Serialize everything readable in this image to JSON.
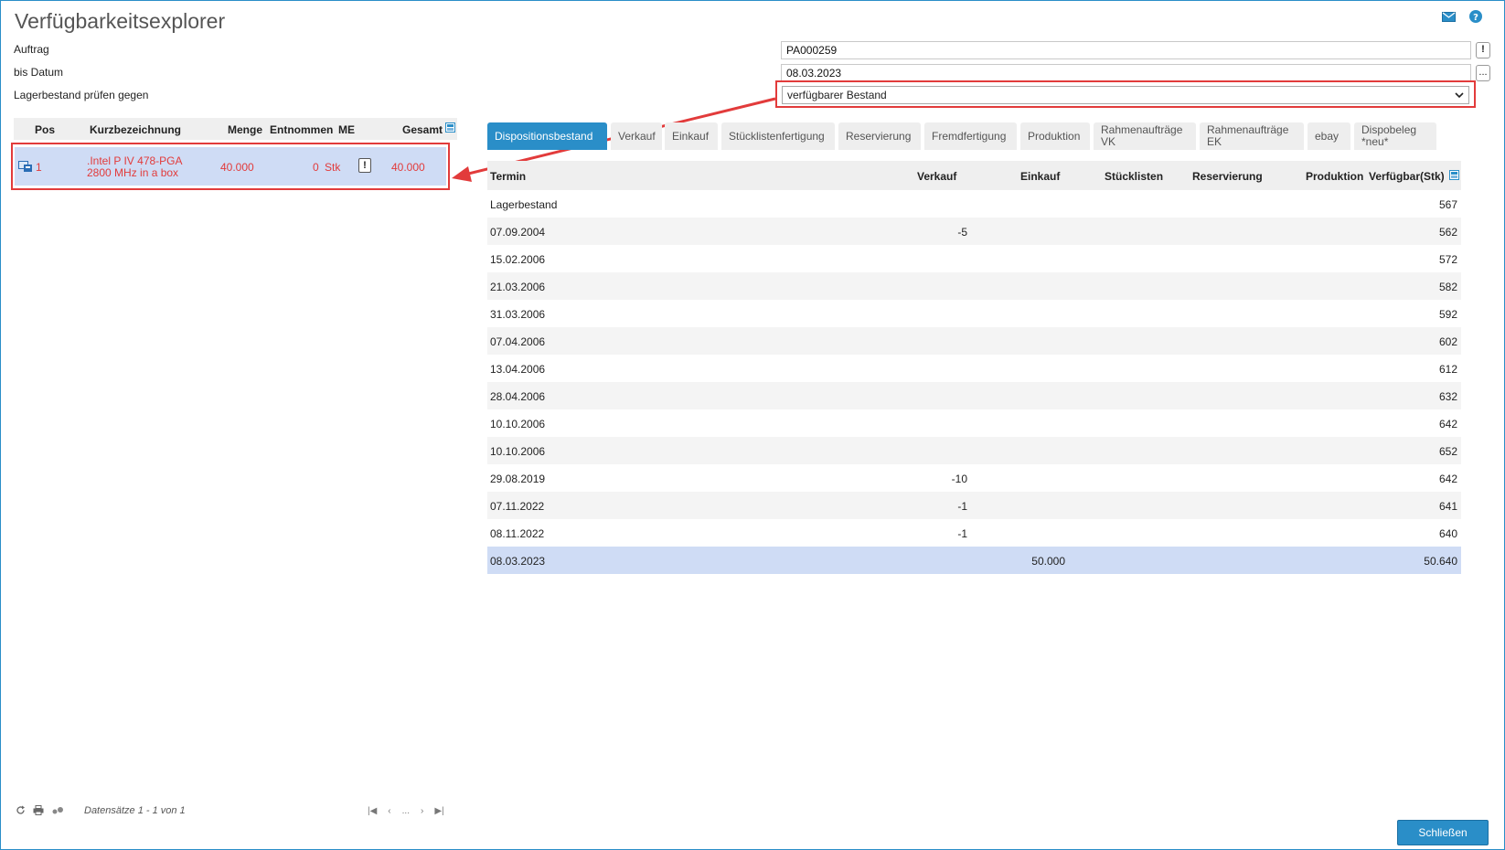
{
  "window_title": "Verfügbarkeitsexplorer",
  "icons": {
    "mail": "mail-icon",
    "help": "help-icon"
  },
  "form": {
    "auftrag_label": "Auftrag",
    "auftrag_value": "PA000259",
    "auftrag_btn": "!",
    "datum_label": "bis Datum",
    "datum_value": "08.03.2023",
    "datum_btn": "...",
    "lager_label": "Lagerbestand prüfen gegen",
    "lager_value": "verfügbarer Bestand"
  },
  "left_grid": {
    "headers": {
      "pos": "Pos",
      "kurz": "Kurzbezeichnung",
      "menge": "Menge",
      "entnommen": "Entnommen",
      "me": "ME",
      "gesamt": "Gesamt"
    },
    "row": {
      "pos": "1",
      "kurz_line1": ".Intel P IV 478-PGA",
      "kurz_line2": "2800 MHz in a box",
      "menge": "40.000",
      "entnommen": "0",
      "me": "Stk",
      "info": "!",
      "gesamt": "40.000"
    }
  },
  "tabs": [
    {
      "label": "Dispositionsbestand",
      "active": true
    },
    {
      "label": "Verkauf"
    },
    {
      "label": "Einkauf"
    },
    {
      "label": "Stücklistenfertigung"
    },
    {
      "label": "Reservierung"
    },
    {
      "label": "Fremdfertigung"
    },
    {
      "label": "Produktion"
    },
    {
      "line1": "Rahmenaufträge",
      "line2": "VK"
    },
    {
      "line1": "Rahmenaufträge",
      "line2": "EK"
    },
    {
      "label": "ebay"
    },
    {
      "line1": "Dispobeleg",
      "line2": "*neu*"
    }
  ],
  "right_grid": {
    "headers": {
      "termin": "Termin",
      "verkauf": "Verkauf",
      "einkauf": "Einkauf",
      "stueck": "Stücklisten",
      "reserv": "Reservierung",
      "prod": "Produktion",
      "verf": "Verfügbar(Stk)"
    },
    "rows": [
      {
        "termin": "Lagerbestand",
        "verkauf": "",
        "einkauf": "",
        "verf": "567"
      },
      {
        "termin": "07.09.2004",
        "verkauf": "-5",
        "einkauf": "",
        "verf": "562"
      },
      {
        "termin": "15.02.2006",
        "verkauf": "",
        "einkauf": "",
        "verf": "572"
      },
      {
        "termin": "21.03.2006",
        "verkauf": "",
        "einkauf": "",
        "verf": "582"
      },
      {
        "termin": "31.03.2006",
        "verkauf": "",
        "einkauf": "",
        "verf": "592"
      },
      {
        "termin": "07.04.2006",
        "verkauf": "",
        "einkauf": "",
        "verf": "602"
      },
      {
        "termin": "13.04.2006",
        "verkauf": "",
        "einkauf": "",
        "verf": "612"
      },
      {
        "termin": "28.04.2006",
        "verkauf": "",
        "einkauf": "",
        "verf": "632"
      },
      {
        "termin": "10.10.2006",
        "verkauf": "",
        "einkauf": "",
        "verf": "642"
      },
      {
        "termin": "10.10.2006",
        "verkauf": "",
        "einkauf": "",
        "verf": "652"
      },
      {
        "termin": "29.08.2019",
        "verkauf": "-10",
        "einkauf": "",
        "verf": "642"
      },
      {
        "termin": "07.11.2022",
        "verkauf": "-1",
        "einkauf": "",
        "verf": "641"
      },
      {
        "termin": "08.11.2022",
        "verkauf": "-1",
        "einkauf": "",
        "verf": "640"
      },
      {
        "termin": "08.03.2023",
        "verkauf": "",
        "einkauf": "50.000",
        "verf": "50.640"
      }
    ]
  },
  "footer": {
    "records": "Datensätze 1 - 1 von 1",
    "pager_mid": "...",
    "close_label": "Schließen"
  }
}
